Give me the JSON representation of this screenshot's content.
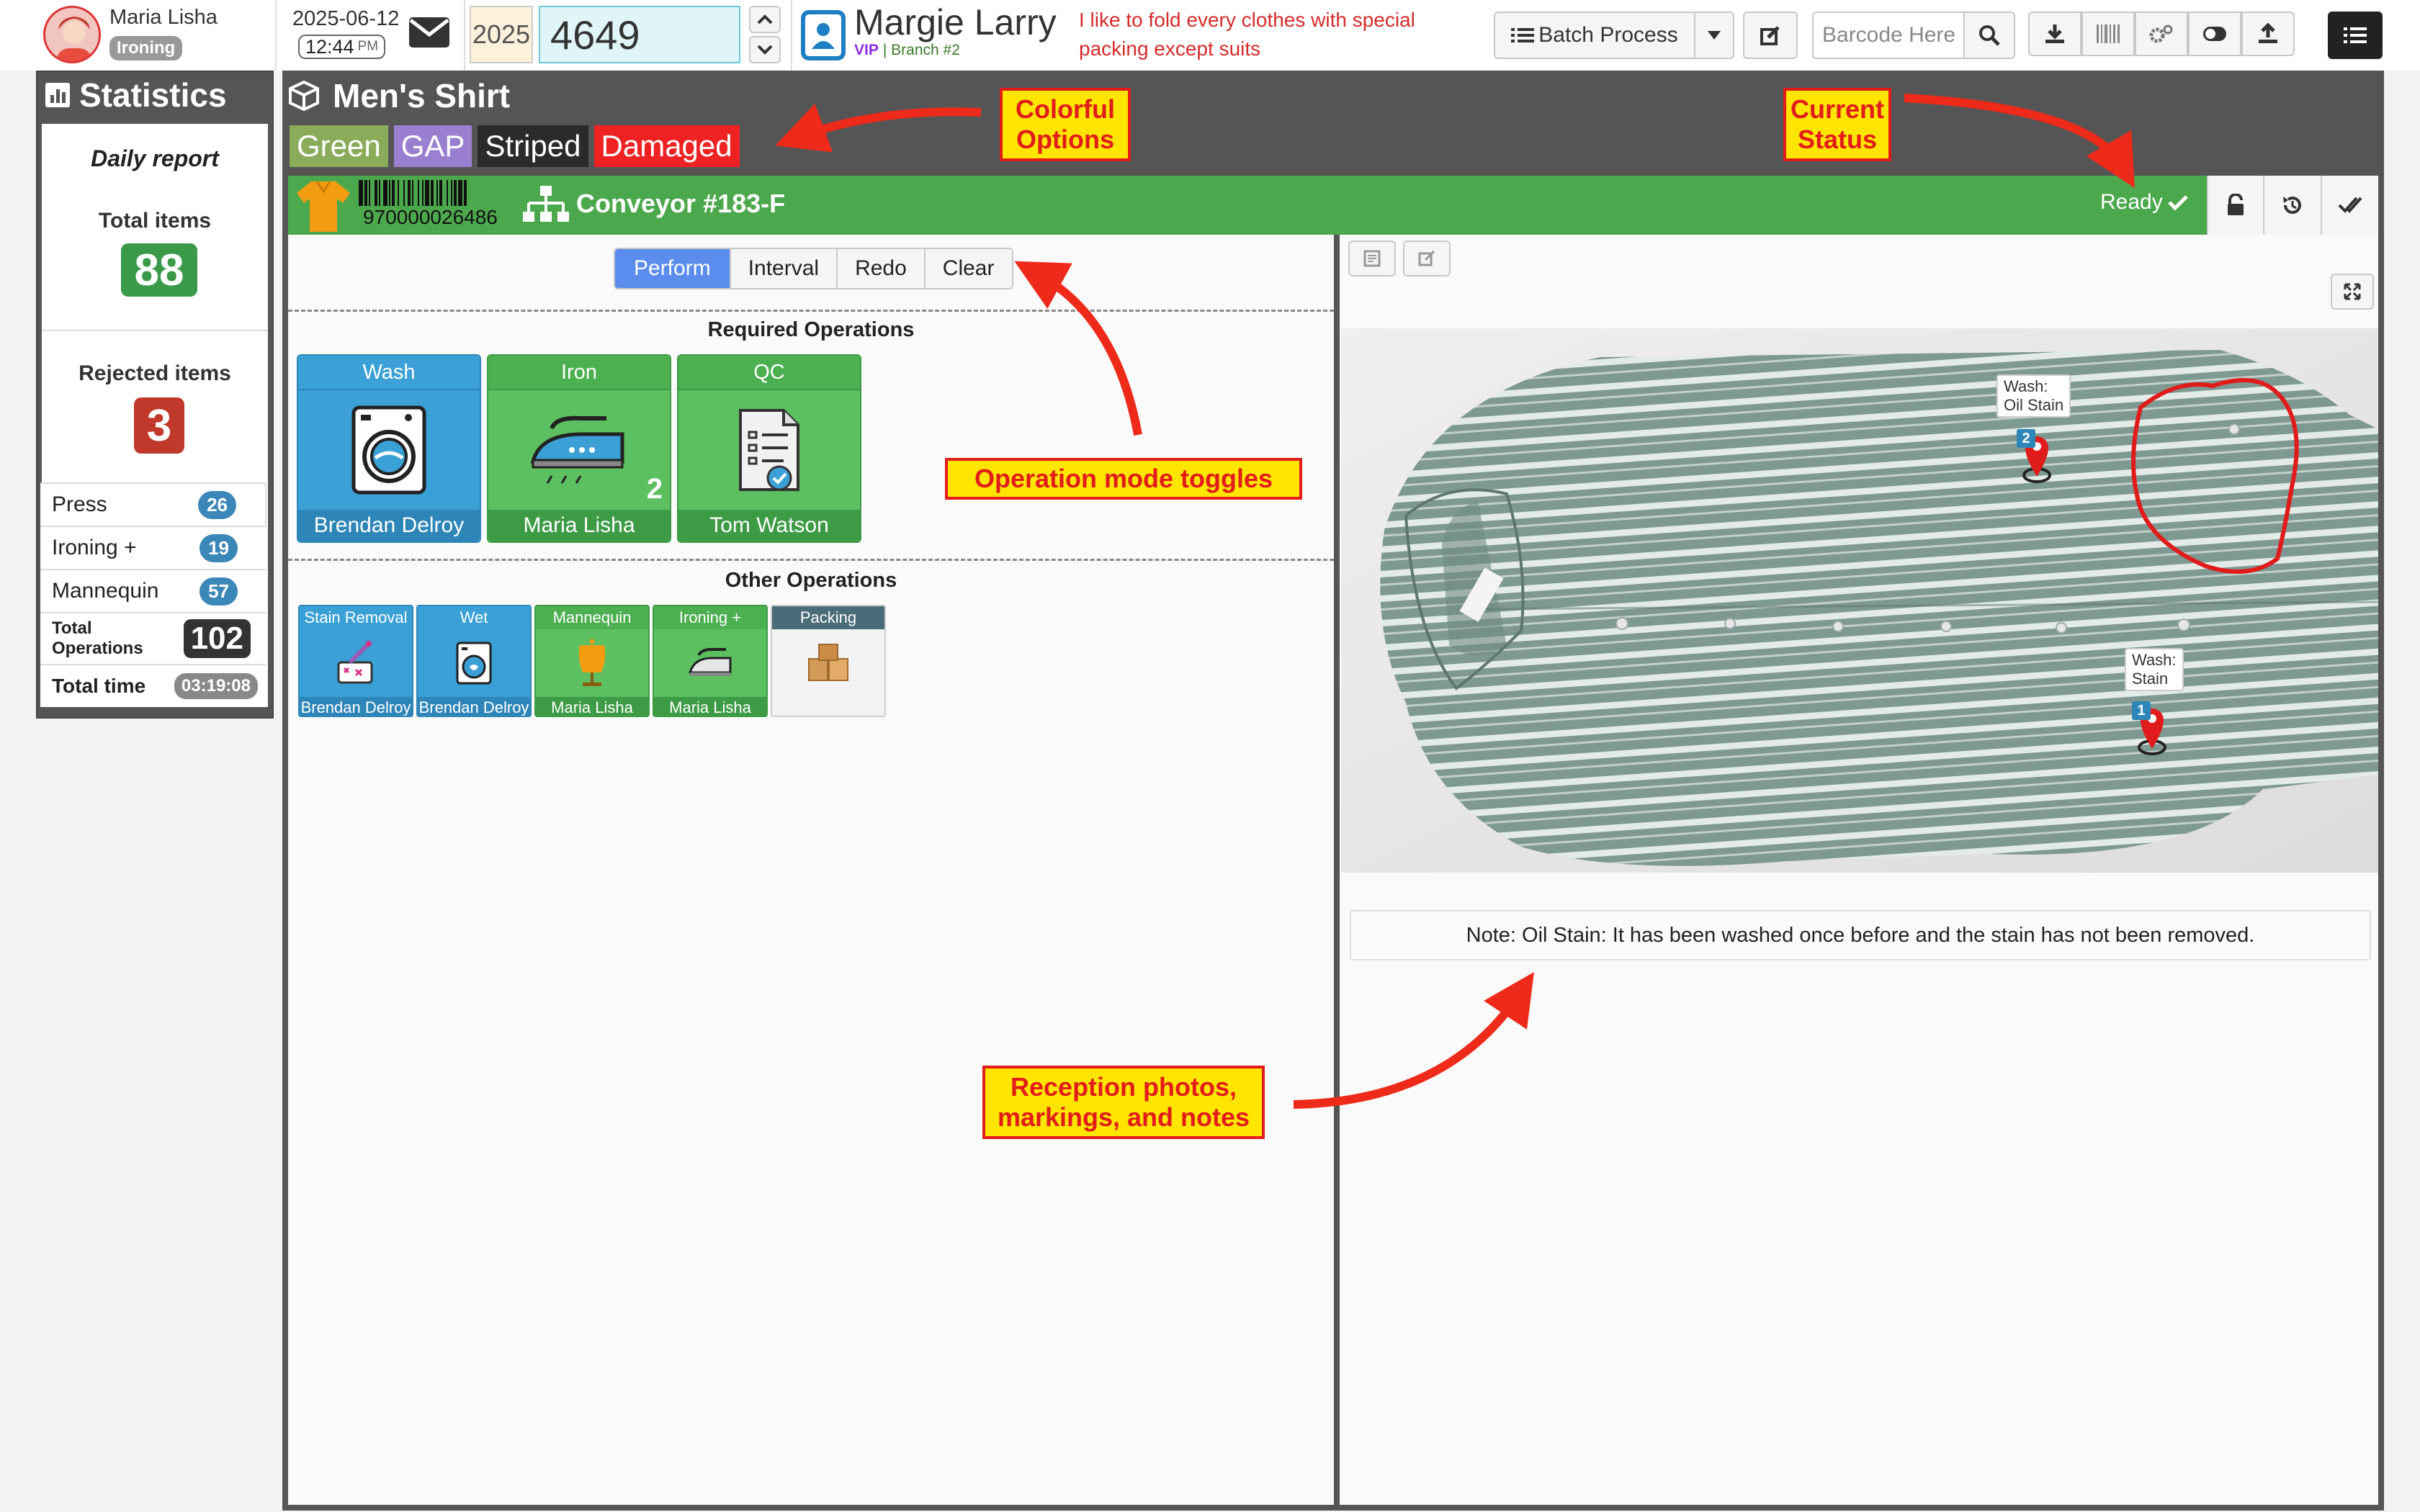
{
  "user": {
    "name": "Maria Lisha",
    "role": "Ironing"
  },
  "datetime": {
    "date": "2025-06-12",
    "time": "12:44",
    "ampm": "PM"
  },
  "order": {
    "year": "2025",
    "number": "4649"
  },
  "customer": {
    "name": "Margie Larry",
    "vip": "VIP",
    "branch": "| Branch #2",
    "note": "I like to fold every clothes with special packing except suits"
  },
  "toolbar": {
    "batch_label": "Batch Process",
    "barcode_placeholder": "Barcode Here"
  },
  "stats": {
    "title": "Statistics",
    "daily": "Daily report",
    "total_label": "Total items",
    "total_value": "88",
    "rejected_label": "Rejected items",
    "rejected_value": "3",
    "rows": [
      {
        "label": "Press",
        "value": "26"
      },
      {
        "label": "Ironing +",
        "value": "19"
      },
      {
        "label": "Mannequin",
        "value": "57"
      }
    ],
    "total_ops_label": "Total Operations",
    "total_ops_value": "102",
    "total_time_label": "Total time",
    "total_time_value": "03:19:08"
  },
  "item": {
    "title": "Men's Shirt",
    "barcode": "970000026486",
    "conveyor": "Conveyor #183-F",
    "status": "Ready"
  },
  "tags": [
    {
      "label": "Green",
      "color": "#8aac5a"
    },
    {
      "label": "GAP",
      "color": "#9a7fd0"
    },
    {
      "label": "Striped",
      "color": "#2b2b2b"
    },
    {
      "label": "Damaged",
      "color": "#ee2222"
    }
  ],
  "modes": [
    "Perform",
    "Interval",
    "Redo",
    "Clear"
  ],
  "required": {
    "title": "Required Operations",
    "ops": [
      {
        "name": "Wash",
        "user": "Brendan Delroy",
        "icon": "washing-machine-icon",
        "count": ""
      },
      {
        "name": "Iron",
        "user": "Maria Lisha",
        "icon": "iron-icon",
        "count": "2"
      },
      {
        "name": "QC",
        "user": "Tom Watson",
        "icon": "checklist-icon",
        "count": ""
      }
    ]
  },
  "other": {
    "title": "Other Operations",
    "ops": [
      {
        "name": "Stain Removal",
        "user": "Brendan Delroy",
        "icon": "stain-spray-icon"
      },
      {
        "name": "Wet",
        "user": "Brendan Delroy",
        "icon": "wet-wash-icon"
      },
      {
        "name": "Mannequin",
        "user": "Maria Lisha",
        "icon": "mannequin-icon"
      },
      {
        "name": "Ironing +",
        "user": "Maria Lisha",
        "icon": "iron-icon"
      },
      {
        "name": "Packing",
        "user": "",
        "icon": "box-icon"
      }
    ]
  },
  "markers": [
    {
      "n": "2",
      "label1": "Wash:",
      "label2": "Oil Stain"
    },
    {
      "n": "1",
      "label1": "Wash:",
      "label2": "Stain"
    }
  ],
  "note": "Note: Oil Stain: It has been washed once before and the stain has not been removed.",
  "callouts": {
    "options": [
      "Colorful",
      "Options"
    ],
    "status": [
      "Current",
      "Status"
    ],
    "modes": "Operation mode toggles",
    "reception": [
      "Reception photos,",
      "markings, and notes"
    ]
  },
  "colors": {
    "green": "#4caf50",
    "dark": "#555555",
    "blue": "#3a9fd6",
    "red": "#ee2222",
    "accent": "#5b8def"
  }
}
